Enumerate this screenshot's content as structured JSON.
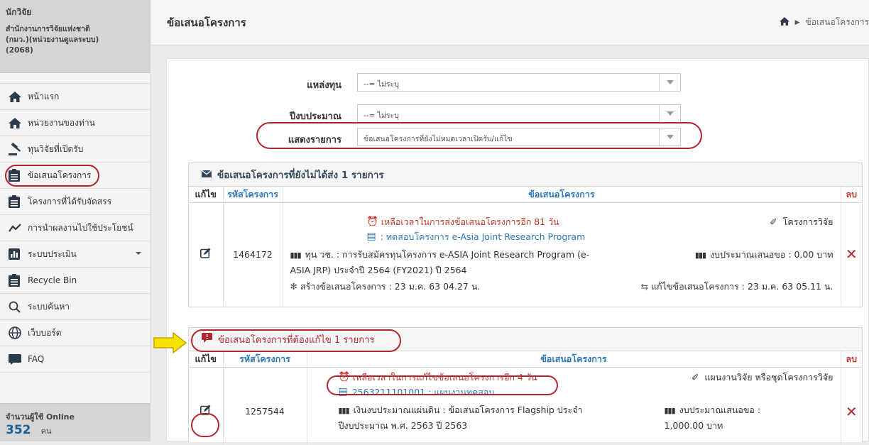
{
  "sidebar": {
    "role": "นักวิจัย",
    "org_line1": "สำนักงานการวิจัยแห่งชาติ",
    "org_line2": "(กมว.)(หน่วยงานดูแลระบบ)",
    "org_code": "(2068)",
    "items": [
      {
        "label": "หน้าแรก",
        "icon": "home-icon"
      },
      {
        "label": "หน่วยงานของท่าน",
        "icon": "home-icon"
      },
      {
        "label": "ทุนวิจัยที่เปิดรับ",
        "icon": "gavel-icon"
      },
      {
        "label": "ข้อเสนอโครงการ",
        "icon": "clipboard-icon"
      },
      {
        "label": "โครงการที่ได้รับจัดสรร",
        "icon": "clipboard-icon"
      },
      {
        "label": "การนำผลงานไปใช้ประโยชน์",
        "icon": "line-chart-icon"
      },
      {
        "label": "ระบบประเมิน",
        "icon": "bar-chart-icon"
      },
      {
        "label": "Recycle Bin",
        "icon": "clipboard-icon"
      },
      {
        "label": "ระบบค้นหา",
        "icon": "search-icon"
      },
      {
        "label": "เว็บบอร์ด",
        "icon": "globe-icon"
      },
      {
        "label": "FAQ",
        "icon": "chat-icon"
      }
    ],
    "online_label": "จำนวนผู้ใช้ Online",
    "online_count": "352",
    "online_unit": "คน"
  },
  "header": {
    "title": "ข้อเสนอโครงการ",
    "breadcrumb_current": "ข้อเสนอโครงการ"
  },
  "filters": {
    "fund_source_label": "แหล่งทุน",
    "fund_source_value": "--= ไม่ระบุ",
    "fiscal_year_label": "ปีงบประมาณ",
    "fiscal_year_value": "--= ไม่ระบุ",
    "display_label": "แสดงรายการ",
    "display_value": "ข้อเสนอโครงการที่ยังไม่หมดเวลาเปิดรับ/แก้ไข"
  },
  "section_unsent": {
    "title": "ข้อเสนอโครงการที่ยังไม่ได้ส่ง 1 รายการ",
    "col_edit": "แก้ไข",
    "col_code": "รหัสโครงการ",
    "col_proposal": "ข้อเสนอโครงการ",
    "col_delete": "ลบ",
    "row": {
      "code": "1464172",
      "remaining": "เหลือเวลาในการส่งข้อเสนอโครงการอีก 81 วัน",
      "type": "โครงการวิจัย",
      "name": ": ทดสอบโครงการ e-Asia Joint Research Program",
      "fund_line1": "ทุน วช. : การรับสมัครทุนโครงการ e-ASIA Joint Research Program (e-",
      "fund_line2": "ASIA JRP) ประจำปี 2564 (FY2021) ปี 2564",
      "budget": "งบประมาณเสนอขอ : 0.00 บาท",
      "created": "สร้างข้อเสนอโครงการ : 23 ม.ค. 63 04.27 น.",
      "modified": "แก้ไขข้อเสนอโครงการ : 23 ม.ค. 63 05.11 น."
    }
  },
  "section_revise": {
    "title": "ข้อเสนอโครงการที่ต้องแก้ไข 1 รายการ",
    "col_edit": "แก้ไข",
    "col_code": "รหัสโครงการ",
    "col_proposal": "ข้อเสนอโครงการ",
    "col_delete": "ลบ",
    "row": {
      "code": "1257544",
      "remaining": "เหลือเวลาในการแก้ไขข้อเสนอโครงการอีก 4 วัน",
      "type": "แผนงานวิจัย หรือชุดโครงการวิจัย",
      "name": "2563211101001 : แผนงานทดสอบ",
      "fund_line1": "เงินงบประมาณแผ่นดิน : ข้อเสนอโครงการ Flagship ประจำ",
      "fund_line2": "ปีงบประมาณ พ.ศ. 2563 ปี 2563",
      "budget_line1": "งบประมาณเสนอขอ :",
      "budget_line2": "1,000.00 บาท"
    }
  },
  "colors": {
    "accent_blue": "#2e77b8",
    "highlight_red": "#b2252f",
    "arrow_yellow": "#f5e400"
  }
}
